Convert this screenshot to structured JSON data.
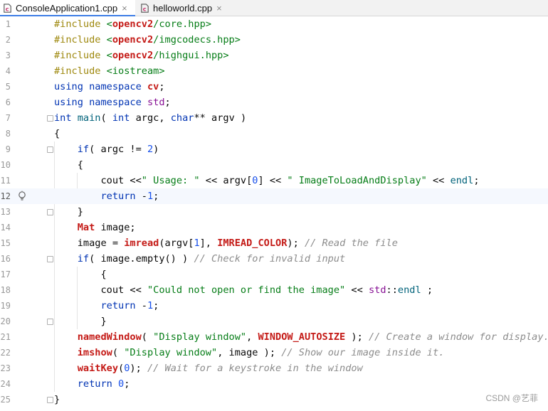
{
  "tabs": [
    {
      "label": "ConsoleApplication1.cpp",
      "active": true,
      "close": "×"
    },
    {
      "label": "helloworld.cpp",
      "active": false,
      "close": "×"
    }
  ],
  "editor": {
    "current_line": 12,
    "lines": [
      {
        "num": "1"
      },
      {
        "num": "2"
      },
      {
        "num": "3"
      },
      {
        "num": "4"
      },
      {
        "num": "5"
      },
      {
        "num": "6"
      },
      {
        "num": "7"
      },
      {
        "num": "8"
      },
      {
        "num": "9"
      },
      {
        "num": "10"
      },
      {
        "num": "11"
      },
      {
        "num": "12"
      },
      {
        "num": "13"
      },
      {
        "num": "14"
      },
      {
        "num": "15"
      },
      {
        "num": "16"
      },
      {
        "num": "17"
      },
      {
        "num": "18"
      },
      {
        "num": "19"
      },
      {
        "num": "20"
      },
      {
        "num": "21"
      },
      {
        "num": "22"
      },
      {
        "num": "23"
      },
      {
        "num": "24"
      },
      {
        "num": "25"
      }
    ],
    "tokens": [
      [
        [
          "#include ",
          "pre"
        ],
        [
          "<",
          "str"
        ],
        [
          "opencv2",
          "api"
        ],
        [
          "/core.hpp>",
          "str"
        ]
      ],
      [
        [
          "#include ",
          "pre"
        ],
        [
          "<",
          "str"
        ],
        [
          "opencv2",
          "api"
        ],
        [
          "/imgcodecs.hpp>",
          "str"
        ]
      ],
      [
        [
          "#include ",
          "pre"
        ],
        [
          "<",
          "str"
        ],
        [
          "opencv2",
          "api"
        ],
        [
          "/highgui.hpp>",
          "str"
        ]
      ],
      [
        [
          "#include ",
          "pre"
        ],
        [
          "<iostream>",
          "str"
        ]
      ],
      [
        [
          "using ",
          "kw"
        ],
        [
          "namespace ",
          "kw"
        ],
        [
          "cv",
          "api"
        ],
        [
          ";",
          ""
        ]
      ],
      [
        [
          "using ",
          "kw"
        ],
        [
          "namespace ",
          "kw"
        ],
        [
          "std",
          "macro"
        ],
        [
          ";",
          ""
        ]
      ],
      [
        [
          "int ",
          "ty"
        ],
        [
          "main",
          "fn"
        ],
        [
          "( ",
          ""
        ],
        [
          "int ",
          "ty"
        ],
        [
          "argc, ",
          ""
        ],
        [
          "char",
          "ty"
        ],
        [
          "** argv )",
          ""
        ]
      ],
      [
        [
          "{",
          ""
        ]
      ],
      [
        [
          "    if",
          "kw"
        ],
        [
          "( argc != ",
          ""
        ],
        [
          "2",
          "num"
        ],
        [
          ")",
          ""
        ]
      ],
      [
        [
          "    {",
          ""
        ]
      ],
      [
        [
          "        cout <<",
          ""
        ],
        [
          "\" Usage: \"",
          "str"
        ],
        [
          " << argv[",
          ""
        ],
        [
          "0",
          "num"
        ],
        [
          "] << ",
          ""
        ],
        [
          "\" ImageToLoadAndDisplay\"",
          "str"
        ],
        [
          " << ",
          ""
        ],
        [
          "endl",
          "fn"
        ],
        [
          ";",
          ""
        ]
      ],
      [
        [
          "        return ",
          "kw"
        ],
        [
          "-",
          ""
        ],
        [
          "1",
          "num"
        ],
        [
          ";",
          ""
        ]
      ],
      [
        [
          "    }",
          ""
        ]
      ],
      [
        [
          "    ",
          ""
        ],
        [
          "Mat",
          "api"
        ],
        [
          " image;",
          ""
        ]
      ],
      [
        [
          "    image = ",
          ""
        ],
        [
          "imread",
          "api"
        ],
        [
          "(argv[",
          ""
        ],
        [
          "1",
          "num"
        ],
        [
          "], ",
          ""
        ],
        [
          "IMREAD_COLOR",
          "api"
        ],
        [
          "); ",
          ""
        ],
        [
          "// Read the file",
          "com"
        ]
      ],
      [
        [
          "    if",
          "kw"
        ],
        [
          "( image.empty() ) ",
          ""
        ],
        [
          "// Check for invalid input",
          "com"
        ]
      ],
      [
        [
          "        {",
          ""
        ]
      ],
      [
        [
          "        cout << ",
          ""
        ],
        [
          "\"Could not open or find the image\"",
          "str"
        ],
        [
          " << ",
          ""
        ],
        [
          "std",
          "macro"
        ],
        [
          "::",
          ""
        ],
        [
          "endl",
          "fn"
        ],
        [
          " ;",
          ""
        ]
      ],
      [
        [
          "        return ",
          "kw"
        ],
        [
          "-",
          ""
        ],
        [
          "1",
          "num"
        ],
        [
          ";",
          ""
        ]
      ],
      [
        [
          "        }",
          ""
        ]
      ],
      [
        [
          "    ",
          ""
        ],
        [
          "namedWindow",
          "api"
        ],
        [
          "( ",
          ""
        ],
        [
          "\"Display window\"",
          "str"
        ],
        [
          ", ",
          ""
        ],
        [
          "WINDOW_AUTOSIZE",
          "api"
        ],
        [
          " ); ",
          ""
        ],
        [
          "// Create a window for display.",
          "com"
        ]
      ],
      [
        [
          "    ",
          ""
        ],
        [
          "imshow",
          "api"
        ],
        [
          "( ",
          ""
        ],
        [
          "\"Display window\"",
          "str"
        ],
        [
          ", image ); ",
          ""
        ],
        [
          "// Show our image inside it.",
          "com"
        ]
      ],
      [
        [
          "    ",
          ""
        ],
        [
          "waitKey",
          "api"
        ],
        [
          "(",
          ""
        ],
        [
          "0",
          "num"
        ],
        [
          "); ",
          ""
        ],
        [
          "// Wait for a keystroke in the window",
          "com"
        ]
      ],
      [
        [
          "    return ",
          "kw"
        ],
        [
          "0",
          "num"
        ],
        [
          ";",
          ""
        ]
      ],
      [
        [
          "}",
          ""
        ]
      ]
    ]
  },
  "watermark": "CSDN @艺菲"
}
